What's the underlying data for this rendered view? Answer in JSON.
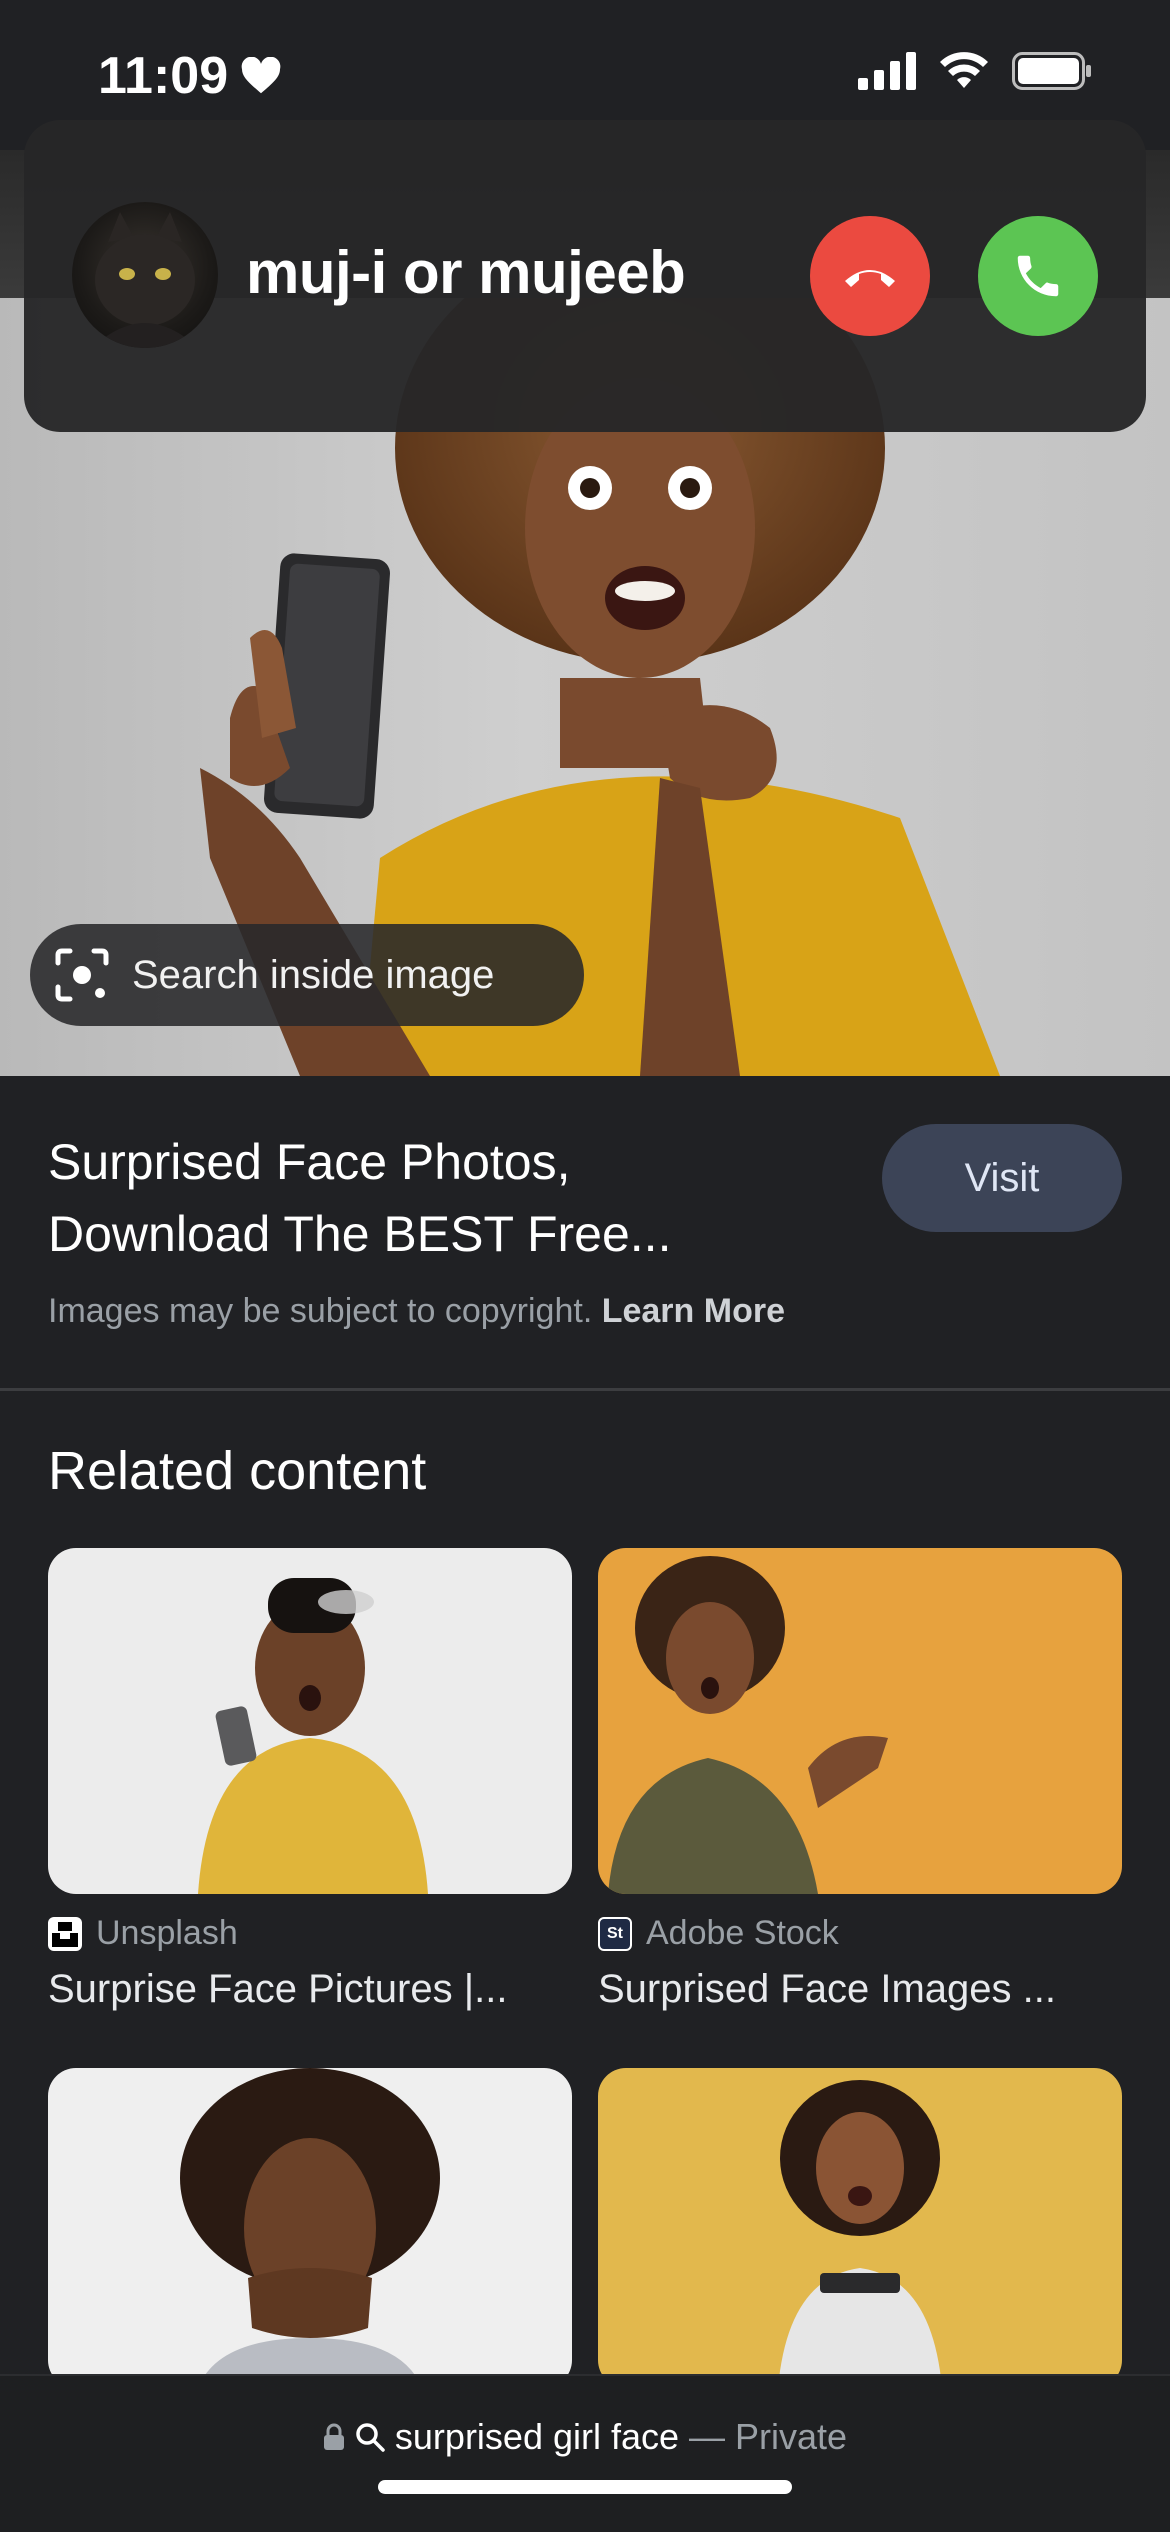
{
  "status_bar": {
    "time": "11:09"
  },
  "call": {
    "caller_name": "muj-i or mujeeb"
  },
  "image": {
    "lens_label": "Search inside image"
  },
  "result": {
    "title_line1": "Surprised Face Photos,",
    "title_line2": "Download The BEST Free...",
    "visit_label": "Visit",
    "copyright_text": "Images may be subject to copyright.",
    "learn_more": "Learn More"
  },
  "related": {
    "title": "Related content",
    "items": [
      {
        "source": "Unsplash",
        "title": "Surprise Face Pictures |..."
      },
      {
        "source": "Adobe Stock",
        "title": "Surprised Face Images ..."
      },
      {
        "source": "",
        "title": ""
      },
      {
        "source": "",
        "title": ""
      }
    ]
  },
  "address_bar": {
    "query": "surprised girl face",
    "separator": "—",
    "mode": "Private"
  },
  "colors": {
    "decline": "#eb4a40",
    "accept": "#5cc553",
    "visit_bg": "#3c4457",
    "background": "#202124"
  }
}
